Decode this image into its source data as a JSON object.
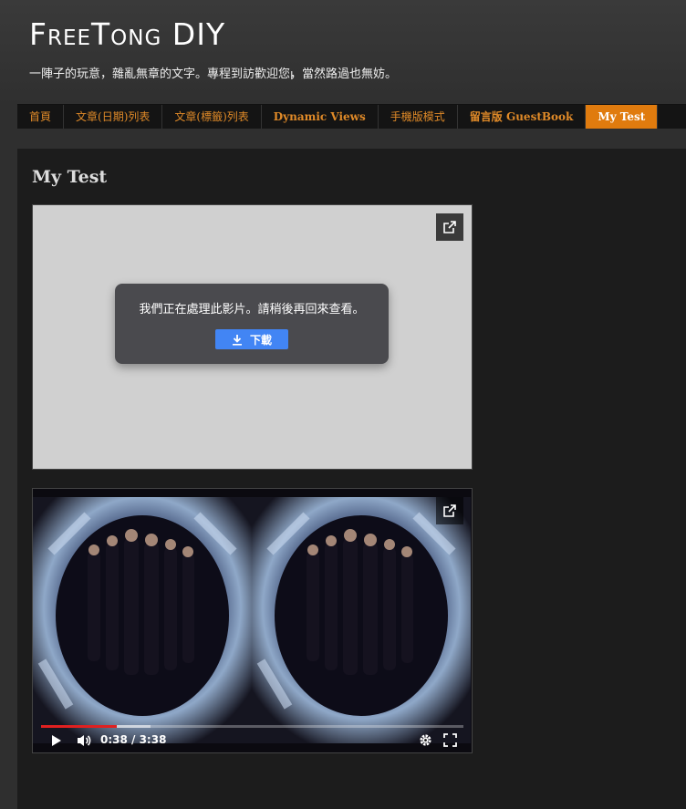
{
  "header": {
    "title": "FreeTong DIY",
    "description": "一陣子的玩意，雜亂無章的文字。專程到訪歡迎您，當然路過也無妨。"
  },
  "nav": {
    "items": [
      {
        "label": "首頁"
      },
      {
        "label": "文章(日期)列表"
      },
      {
        "label": "文章(標籤)列表"
      },
      {
        "label": "Dynamic Views"
      },
      {
        "label": "手機版模式"
      },
      {
        "label": "留言版 GuestBook"
      },
      {
        "label": "My Test"
      }
    ],
    "active_index": 6
  },
  "post": {
    "title": "My Test"
  },
  "video1": {
    "message": "我們正在處理此影片。請稍後再回來查看。",
    "download_label": "下載",
    "external_icon": "open-external-icon"
  },
  "video2": {
    "time": "0:38 / 3:38",
    "progress": 0.18,
    "buffered": 0.26,
    "icons": [
      "play-icon",
      "volume-icon",
      "settings-icon",
      "fullscreen-icon",
      "open-external-icon"
    ]
  },
  "colors": {
    "accent": "#e07b0e",
    "nav_text": "#e08a28",
    "download": "#4285f4",
    "progress": "#e02020"
  }
}
